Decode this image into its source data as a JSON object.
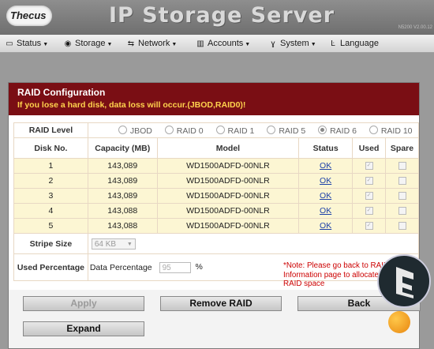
{
  "app": {
    "logo": "Thecus",
    "title": "IP Storage Server",
    "version": "N5200 V2.00.12"
  },
  "menu": [
    {
      "label": "Status",
      "icon": "hdd-icon"
    },
    {
      "label": "Storage",
      "icon": "disc-icon"
    },
    {
      "label": "Network",
      "icon": "network-icon"
    },
    {
      "label": "Accounts",
      "icon": "accounts-icon"
    },
    {
      "label": "System",
      "icon": "wrench-icon"
    },
    {
      "label": "Language",
      "icon": "language-icon"
    }
  ],
  "panel": {
    "title": "RAID Configuration",
    "warning": "If you lose a hard disk, data loss will occur.(JBOD,RAID0)!"
  },
  "raid_level": {
    "label": "RAID Level",
    "options": [
      "JBOD",
      "RAID 0",
      "RAID 1",
      "RAID 5",
      "RAID 6",
      "RAID 10"
    ],
    "selected": "RAID 6"
  },
  "table": {
    "headers": [
      "Disk No.",
      "Capacity (MB)",
      "Model",
      "Status",
      "Used",
      "Spare"
    ],
    "rows": [
      {
        "disk": "1",
        "capacity": "143,089",
        "model": "WD1500ADFD-00NLR",
        "status": "OK",
        "used": true,
        "spare": false
      },
      {
        "disk": "2",
        "capacity": "143,089",
        "model": "WD1500ADFD-00NLR",
        "status": "OK",
        "used": true,
        "spare": false
      },
      {
        "disk": "3",
        "capacity": "143,089",
        "model": "WD1500ADFD-00NLR",
        "status": "OK",
        "used": true,
        "spare": false
      },
      {
        "disk": "4",
        "capacity": "143,088",
        "model": "WD1500ADFD-00NLR",
        "status": "OK",
        "used": true,
        "spare": false
      },
      {
        "disk": "5",
        "capacity": "143,088",
        "model": "WD1500ADFD-00NLR",
        "status": "OK",
        "used": true,
        "spare": false
      }
    ]
  },
  "stripe": {
    "label": "Stripe Size",
    "value": "64 KB"
  },
  "used_pct": {
    "label": "Used Percentage",
    "field_label": "Data Percentage",
    "value": "95",
    "unit": "%"
  },
  "note": "*Note: Please go back to RAID Information page to allocate unused RAID space",
  "buttons": {
    "apply": "Apply",
    "remove": "Remove RAID",
    "back": "Back",
    "expand": "Expand"
  },
  "colors": {
    "header_bg": "#7a0e14",
    "warning": "#ffd34d",
    "row_bg": "#fcf6d3",
    "note": "#cc0000"
  }
}
